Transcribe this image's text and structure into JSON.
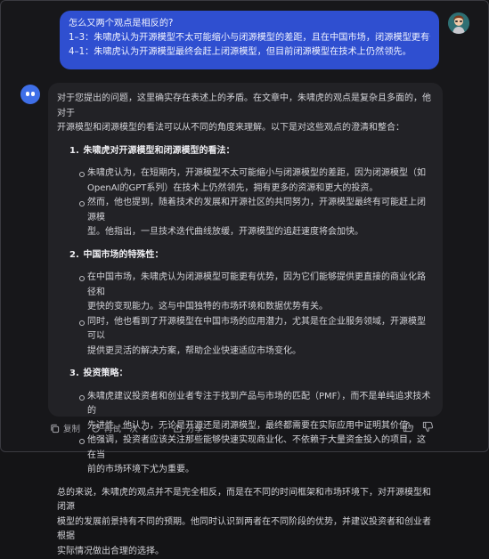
{
  "user_message": {
    "line1": "怎么又两个观点是相反的?",
    "line2": "1–3：朱啸虎认为开源模型不太可能缩小与闭源模型的差距，且在中国市场，闭源模型更有优势。",
    "line3": "4–1：朱啸虎认为开源模型最终会赶上闭源模型，但目前闭源模型在技术上仍然领先。"
  },
  "reply": {
    "intro": [
      "对于您提出的问题，这里确实存在表述上的矛盾。在文章中，朱啸虎的观点是复杂且多面的，他对于",
      "开源模型和闭源模型的看法可以从不同的角度来理解。以下是对这些观点的澄清和整合："
    ],
    "sections": [
      {
        "num": "1.",
        "title": "朱啸虎对开源模型和闭源模型的看法：",
        "bullets": [
          [
            "朱啸虎认为，在短期内，开源模型不太可能缩小与闭源模型的差距，因为闭源模型（如",
            "OpenAI的GPT系列）在技术上仍然领先，拥有更多的资源和更大的投资。"
          ],
          [
            "然而，他也提到，随着技术的发展和开源社区的共同努力，开源模型最终有可能赶上闭源模",
            "型。他指出，一旦技术迭代曲线放缓，开源模型的追赶速度将会加快。"
          ]
        ]
      },
      {
        "num": "2.",
        "title": "中国市场的特殊性：",
        "bullets": [
          [
            "在中国市场，朱啸虎认为闭源模型可能更有优势，因为它们能够提供更直接的商业化路径和",
            "更快的变现能力。这与中国独特的市场环境和数据优势有关。"
          ],
          [
            "同时，他也看到了开源模型在中国市场的应用潜力，尤其是在企业服务领域，开源模型可以",
            "提供更灵活的解决方案，帮助企业快速适应市场变化。"
          ]
        ]
      },
      {
        "num": "3.",
        "title": "投资策略：",
        "bullets": [
          [
            "朱啸虎建议投资者和创业者专注于找到产品与市场的匹配（PMF），而不是单纯追求技术的",
            "先进性。他认为，无论是开源还是闭源模型，最终都需要在实际应用中证明其价值。"
          ],
          [
            "他强调，投资者应该关注那些能够快速实现商业化、不依赖于大量资金投入的项目，这在当",
            "前的市场环境下尤为重要。"
          ]
        ]
      }
    ],
    "conclusion": [
      "总的来说，朱啸虎的观点并不是完全相反，而是在不同的时间框架和市场环境下，对开源模型和闭源",
      "模型的发展前景持有不同的预期。他同时认识到两者在不同阶段的优势，并建议投资者和创业者根据",
      "实际情况做出合理的选择。"
    ]
  },
  "actions": {
    "copy": "复制",
    "retry": "再试一次",
    "share": "分享"
  },
  "icons": [
    "copy-icon",
    "retry-icon",
    "chevron-down-icon",
    "share-icon",
    "thumbs-up-icon",
    "thumbs-down-icon"
  ],
  "colors": {
    "user_bubble": "#2f4fd0",
    "bot_bubble": "#222226",
    "background": "#17171a",
    "bot_avatar": "#3f6fe8"
  }
}
